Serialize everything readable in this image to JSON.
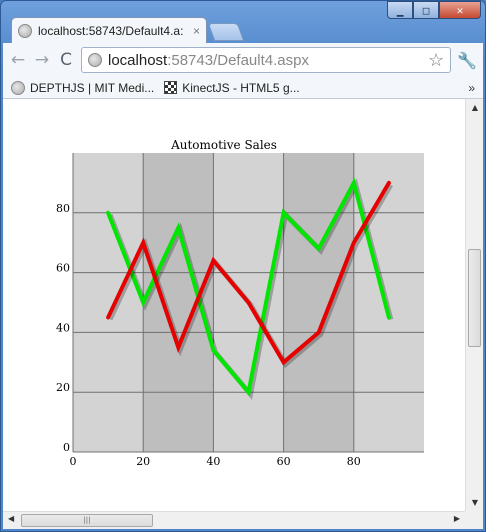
{
  "window": {
    "minimize_glyph": "▁",
    "maximize_glyph": "□",
    "close_glyph": "✕"
  },
  "tab": {
    "title": "localhost:58743/Default4.a:",
    "close_glyph": "×",
    "icon": "globe-icon"
  },
  "toolbar": {
    "back_glyph": "←",
    "forward_glyph": "→",
    "reload_glyph": "C",
    "url_host": "localhost",
    "url_path": ":58743/Default4.aspx",
    "star_glyph": "☆",
    "wrench_glyph": "🔧"
  },
  "bookmarks": {
    "items": [
      {
        "label": "DEPTHJS | MIT Medi...",
        "icon": "globe-icon"
      },
      {
        "label": "KinectJS - HTML5 g...",
        "icon": "checker-icon"
      }
    ],
    "more_glyph": "»"
  },
  "chart_data": {
    "type": "line",
    "title": "Automotive Sales",
    "xlim": [
      0,
      100
    ],
    "ylim": [
      0,
      100
    ],
    "xticks": [
      0,
      20,
      40,
      60,
      80
    ],
    "yticks": [
      0,
      20,
      40,
      60,
      80
    ],
    "xlabel": "",
    "ylabel": "",
    "grid": true,
    "colors": {
      "background": "#d3d3d3",
      "band": "#bebebe",
      "grid": "#707070"
    },
    "series": [
      {
        "color": "#00e600",
        "points": [
          [
            10,
            80
          ],
          [
            20,
            50
          ],
          [
            30,
            75
          ],
          [
            40,
            34
          ],
          [
            50,
            20
          ],
          [
            60,
            80
          ],
          [
            70,
            68
          ],
          [
            80,
            90
          ],
          [
            90,
            45
          ]
        ]
      },
      {
        "color": "#e60000",
        "points": [
          [
            10,
            45
          ],
          [
            20,
            70
          ],
          [
            30,
            35
          ],
          [
            40,
            64
          ],
          [
            50,
            50
          ],
          [
            60,
            30
          ],
          [
            70,
            40
          ],
          [
            80,
            70
          ],
          [
            90,
            90
          ]
        ]
      }
    ]
  }
}
